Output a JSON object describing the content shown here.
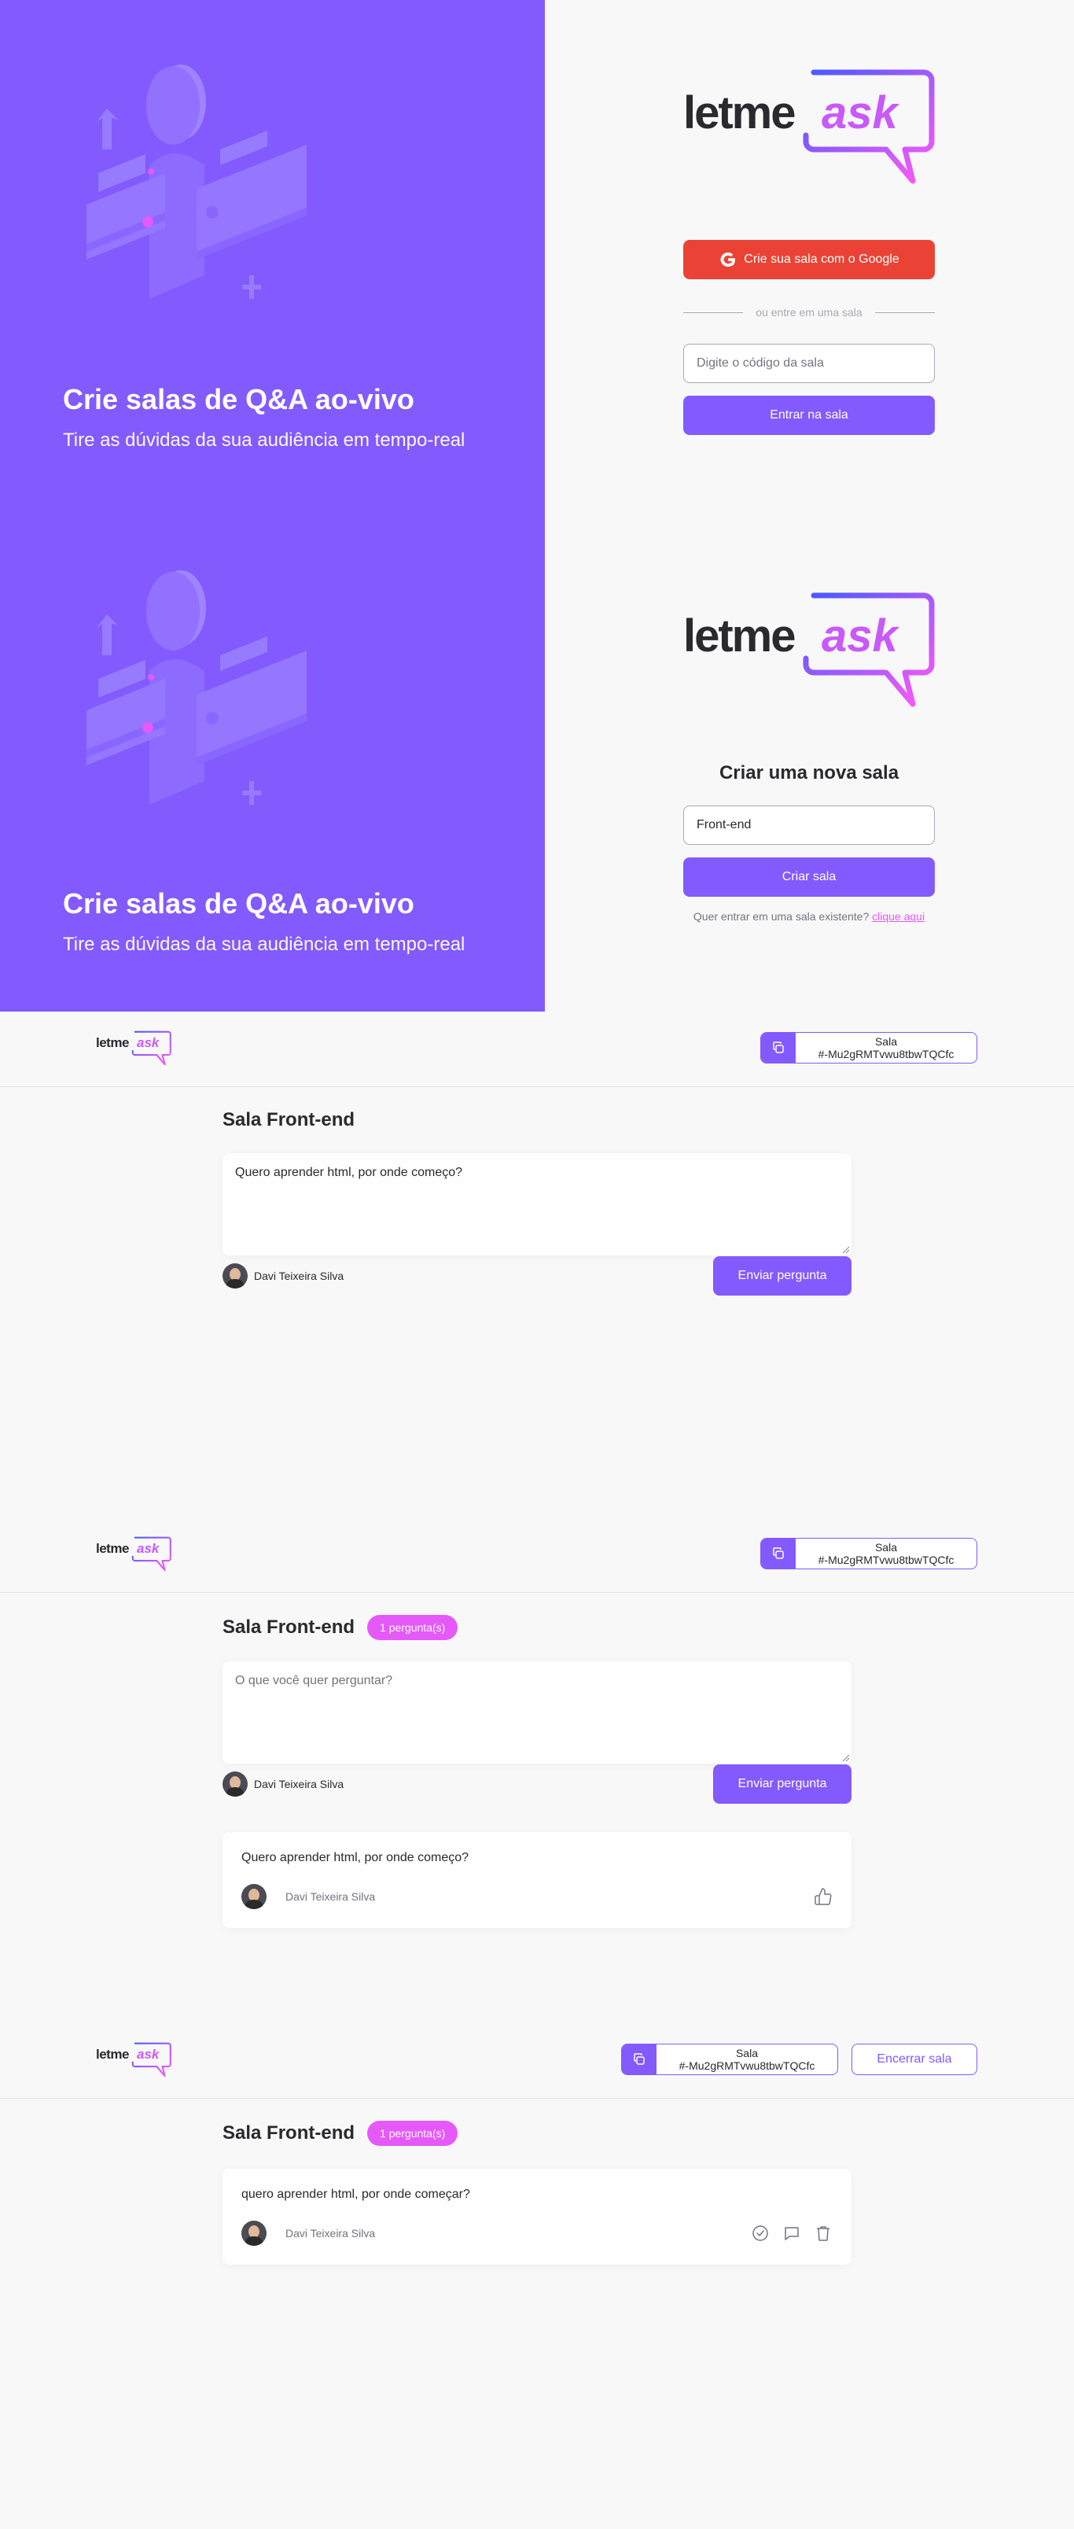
{
  "colors": {
    "primary": "#835afd",
    "pink": "#e559f9",
    "google": "#ea4335",
    "background": "#f8f8f8"
  },
  "brand": {
    "logo_word1": "letme",
    "logo_word2": "ask"
  },
  "auth": {
    "hero_title": "Crie salas de Q&A ao-vivo",
    "hero_subtitle": "Tire as dúvidas da sua audiência em tempo-real"
  },
  "home": {
    "google_button": "Crie sua sala com o Google",
    "google_icon": "google-icon",
    "separator": "ou entre em uma sala",
    "room_code_placeholder": "Digite o código da sala",
    "join_button": "Entrar na sala"
  },
  "new_room": {
    "title": "Criar uma nova sala",
    "room_name_value": "Front-end",
    "create_button": "Criar sala",
    "existing_text": "Quer entrar em uma sala existente?",
    "existing_link": "clique aqui"
  },
  "room": {
    "code_label": "Sala",
    "code_value": "#-Mu2gRMTvwu8tbwTQCfc",
    "title": "Sala Front-end",
    "question_count": "1 pergunta(s)",
    "textarea_value": "Quero aprender html, por onde começo?",
    "textarea_placeholder": "O que você quer perguntar?",
    "user_name": "Davi Teixeira Silva",
    "send_button": "Enviar pergunta",
    "question_text": "Quero aprender html, por onde começo?",
    "question_author": "Davi Teixeira Silva",
    "like_icon": "thumbs-up-icon"
  },
  "admin": {
    "code_label": "Sala",
    "code_value": "#-Mu2gRMTvwu8tbwTQCfc",
    "close_button": "Encerrar sala",
    "title": "Sala Front-end",
    "question_count": "1 pergunta(s)",
    "question_text": "quero aprender html, por onde começar?",
    "question_author": "Davi Teixeira Silva",
    "icons": [
      "check-circle-icon",
      "answer-icon",
      "trash-icon"
    ]
  }
}
